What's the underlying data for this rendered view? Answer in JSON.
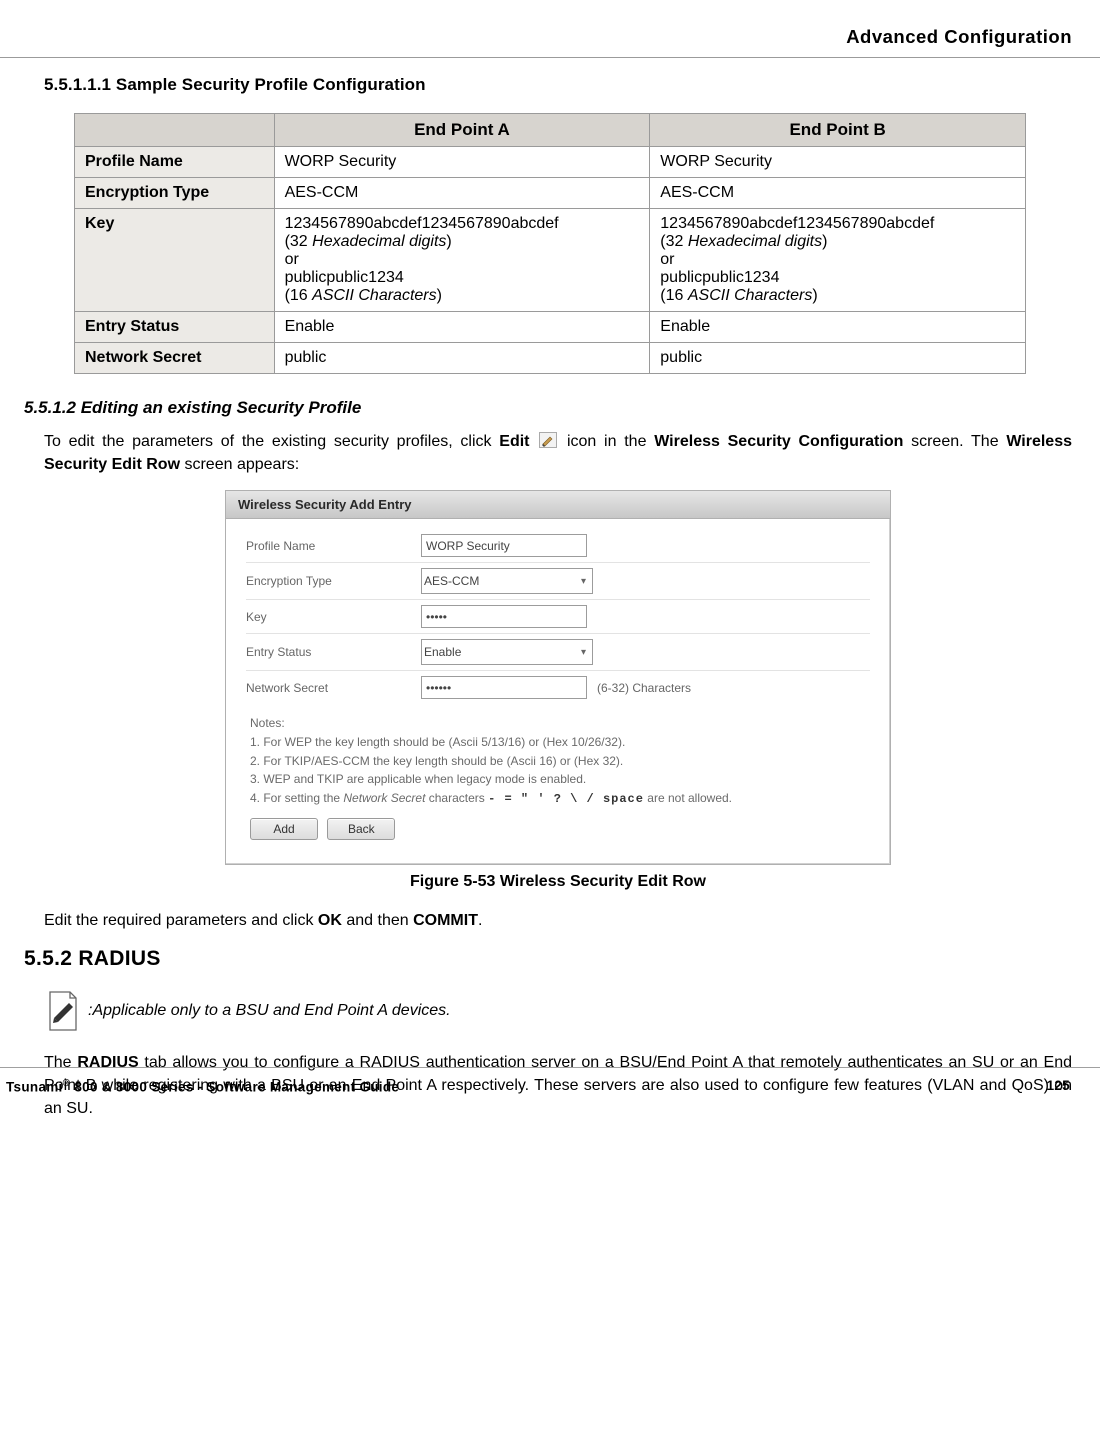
{
  "header": {
    "title": "Advanced Configuration"
  },
  "sec1": {
    "num_title": "5.5.1.1.1 Sample Security Profile Configuration"
  },
  "table": {
    "h_a": "End Point A",
    "h_b": "End Point B",
    "r1_h": "Profile Name",
    "r1_a": "WORP Security",
    "r1_b": "WORP Security",
    "r2_h": "Encryption Type",
    "r2_a": "AES-CCM",
    "r2_b": "AES-CCM",
    "r3_h": "Key",
    "r3_a_l1": "1234567890abcdef1234567890abcdef",
    "r3_a_l2a": "(32 ",
    "r3_a_l2b": "Hexadecimal digits",
    "r3_a_l2c": ")",
    "r3_a_l3": "or",
    "r3_a_l4": "publicpublic1234",
    "r3_a_l5a": "(16 ",
    "r3_a_l5b": "ASCII Characters",
    "r3_a_l5c": ")",
    "r3_b_l1": "1234567890abcdef1234567890abcdef",
    "r3_b_l2a": "(32 ",
    "r3_b_l2b": "Hexadecimal digits",
    "r3_b_l2c": ")",
    "r3_b_l3": "or",
    "r3_b_l4": "publicpublic1234",
    "r3_b_l5a": "(16 ",
    "r3_b_l5b": "ASCII Characters",
    "r3_b_l5c": ")",
    "r4_h": "Entry Status",
    "r4_a": "Enable",
    "r4_b": "Enable",
    "r5_h": "Network Secret",
    "r5_a": "public",
    "r5_b": "public"
  },
  "sec2": {
    "title": "5.5.1.2 Editing an existing Security Profile",
    "p1_a": "To edit the parameters of the existing security profiles, click ",
    "p1_b": "Edit",
    "p1_c": " icon in the ",
    "p1_d": "Wireless Security Configuration",
    "p1_e": " screen. The ",
    "p1_f": "Wireless Security Edit Row",
    "p1_g": " screen appears:"
  },
  "ui": {
    "title": "Wireless Security Add Entry",
    "profile_label": "Profile Name",
    "profile_value": "WORP Security",
    "enc_label": "Encryption Type",
    "enc_value": "AES-CCM",
    "key_label": "Key",
    "key_value": "•••••",
    "status_label": "Entry Status",
    "status_value": "Enable",
    "secret_label": "Network Secret",
    "secret_value": "••••••",
    "secret_hint": "(6-32) Characters",
    "notes_label": "Notes:",
    "note1": "1. For WEP the key length should be (Ascii 5/13/16) or (Hex 10/26/32).",
    "note2": "2. For TKIP/AES-CCM the key length should be (Ascii 16) or (Hex 32).",
    "note3": "3. WEP and TKIP are applicable when legacy mode is enabled.",
    "note4_a": "4. For setting the ",
    "note4_b": "Network Secret",
    "note4_c": " characters   ",
    "note4_d": "- = \" ' ? \\ / space",
    "note4_e": "  are not allowed.",
    "btn_add": "Add",
    "btn_back": "Back"
  },
  "fig": {
    "caption": "Figure 5-53 Wireless Security Edit Row"
  },
  "after_fig": {
    "p_a": "Edit the required parameters and click ",
    "p_b": "OK",
    "p_c": " and then ",
    "p_d": "COMMIT",
    "p_e": "."
  },
  "radius": {
    "heading": "5.5.2 RADIUS",
    "note": ":Applicable only to a BSU and End Point A devices.",
    "p_a": "The ",
    "p_b": "RADIUS",
    "p_c": " tab allows you to configure a RADIUS authentication server on a BSU/End Point A that remotely authenticates an SU or an End Point B while registering with a BSU or an End Point A respectively. These servers are also used to configure few features (VLAN and QoS) on an SU."
  },
  "footer": {
    "left_a": "Tsunami",
    "left_b": " 800 & 8000 Series - Software Management Guide",
    "page": "125"
  }
}
